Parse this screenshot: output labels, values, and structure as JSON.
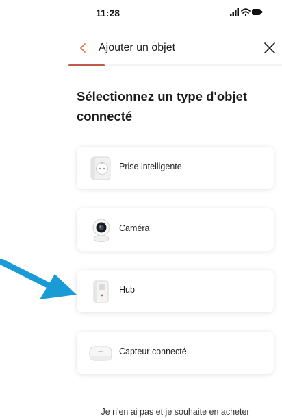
{
  "status_bar": {
    "time": "11:28",
    "icons": [
      "signal-icon",
      "wifi-icon",
      "battery-icon"
    ]
  },
  "header": {
    "title": "Ajouter un objet",
    "back_icon": "chevron-left-icon",
    "close_icon": "close-icon",
    "progress": 0.17
  },
  "page_title": "Sélectionnez un type d'objet connecté",
  "options": [
    {
      "label": "Prise intelligente",
      "icon": "smart-plug-icon"
    },
    {
      "label": "Caméra",
      "icon": "camera-icon"
    },
    {
      "label": "Hub",
      "icon": "hub-icon"
    },
    {
      "label": "Capteur connecté",
      "icon": "sensor-icon"
    }
  ],
  "footer_link": "Je n'en ai pas et je souhaite en acheter",
  "colors": {
    "accent": "#c25a4a",
    "back_chevron": "#e07a45",
    "annotation_arrow": "#1a9bd6"
  }
}
